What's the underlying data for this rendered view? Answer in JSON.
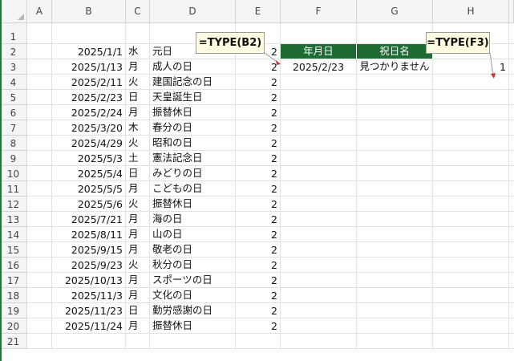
{
  "columns": [
    "A",
    "B",
    "C",
    "D",
    "E",
    "F",
    "G",
    "H"
  ],
  "rows": [
    "1",
    "2",
    "3",
    "4",
    "5",
    "6",
    "7",
    "8",
    "9",
    "10",
    "11",
    "12",
    "13",
    "14",
    "15",
    "16",
    "17",
    "18",
    "19",
    "20",
    "21"
  ],
  "holiday_table": [
    {
      "date": "2025/1/1",
      "weekday": "水",
      "name": "元日",
      "type": "2"
    },
    {
      "date": "2025/1/13",
      "weekday": "月",
      "name": "成人の日",
      "type": "2"
    },
    {
      "date": "2025/2/11",
      "weekday": "火",
      "name": "建国記念の日",
      "type": "2"
    },
    {
      "date": "2025/2/23",
      "weekday": "日",
      "name": "天皇誕生日",
      "type": "2"
    },
    {
      "date": "2025/2/24",
      "weekday": "月",
      "name": "振替休日",
      "type": "2"
    },
    {
      "date": "2025/3/20",
      "weekday": "木",
      "name": "春分の日",
      "type": "2"
    },
    {
      "date": "2025/4/29",
      "weekday": "火",
      "name": "昭和の日",
      "type": "2"
    },
    {
      "date": "2025/5/3",
      "weekday": "土",
      "name": "憲法記念日",
      "type": "2"
    },
    {
      "date": "2025/5/4",
      "weekday": "日",
      "name": "みどりの日",
      "type": "2"
    },
    {
      "date": "2025/5/5",
      "weekday": "月",
      "name": "こどもの日",
      "type": "2"
    },
    {
      "date": "2025/5/6",
      "weekday": "火",
      "name": "振替休日",
      "type": "2"
    },
    {
      "date": "2025/7/21",
      "weekday": "月",
      "name": "海の日",
      "type": "2"
    },
    {
      "date": "2025/8/11",
      "weekday": "月",
      "name": "山の日",
      "type": "2"
    },
    {
      "date": "2025/9/15",
      "weekday": "月",
      "name": "敬老の日",
      "type": "2"
    },
    {
      "date": "2025/9/23",
      "weekday": "火",
      "name": "秋分の日",
      "type": "2"
    },
    {
      "date": "2025/10/13",
      "weekday": "月",
      "name": "スポーツの日",
      "type": "2"
    },
    {
      "date": "2025/11/3",
      "weekday": "月",
      "name": "文化の日",
      "type": "2"
    },
    {
      "date": "2025/11/23",
      "weekday": "日",
      "name": "勤労感謝の日",
      "type": "2"
    },
    {
      "date": "2025/11/24",
      "weekday": "月",
      "name": "振替休日",
      "type": "2"
    }
  ],
  "lookup": {
    "header_date": "年月日",
    "header_name": "祝日名",
    "date_value": "2025/2/23",
    "name_value": "見つかりません",
    "h3_value": "1"
  },
  "callouts": {
    "left": "=TYPE(B2)",
    "right": "=TYPE(F3)"
  },
  "colors": {
    "header_fill": "#1e6b34",
    "callout_fill": "#fffbe0",
    "arrow": "#d03030"
  }
}
